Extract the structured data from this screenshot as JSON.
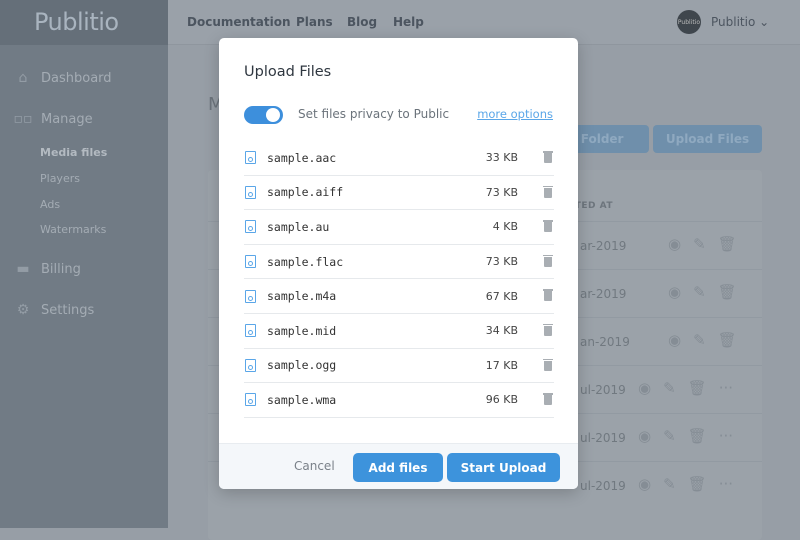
{
  "app": {
    "logo": "Publitio"
  },
  "sidebar": {
    "items": [
      {
        "label": "Dashboard",
        "icon": "home-icon"
      },
      {
        "label": "Manage",
        "icon": "grid-icon"
      },
      {
        "label": "Billing",
        "icon": "credit-card-icon"
      },
      {
        "label": "Settings",
        "icon": "gear-icon"
      }
    ],
    "manage_sub": [
      {
        "label": "Media files",
        "active": true
      },
      {
        "label": "Players"
      },
      {
        "label": "Ads"
      },
      {
        "label": "Watermarks"
      }
    ]
  },
  "topbar": {
    "links": [
      "Documentation",
      "Plans",
      "Blog",
      "Help"
    ],
    "user": "Publitio",
    "avatar": "Publitio"
  },
  "background": {
    "title": "M",
    "new_folder": "w Folder",
    "upload_files": "Upload Files",
    "col_created": "ATED AT",
    "dates": [
      "ar-2019",
      "ar-2019",
      "an-2019",
      "ul-2019",
      "ul-2019",
      "ul-2019"
    ]
  },
  "modal": {
    "title": "Upload Files",
    "privacy_label": "Set files privacy to Public",
    "privacy_on": true,
    "more_options": "more options",
    "files": [
      {
        "name": "sample.aac",
        "size": "33 KB"
      },
      {
        "name": "sample.aiff",
        "size": "73 KB"
      },
      {
        "name": "sample.au",
        "size": "4 KB"
      },
      {
        "name": "sample.flac",
        "size": "73 KB"
      },
      {
        "name": "sample.m4a",
        "size": "67 KB"
      },
      {
        "name": "sample.mid",
        "size": "34 KB"
      },
      {
        "name": "sample.ogg",
        "size": "17 KB"
      },
      {
        "name": "sample.wma",
        "size": "96 KB"
      }
    ],
    "cancel": "Cancel",
    "add_files": "Add files",
    "start_upload": "Start Upload"
  },
  "colors": {
    "accent": "#3d93dc",
    "link": "#5aa6e8"
  }
}
